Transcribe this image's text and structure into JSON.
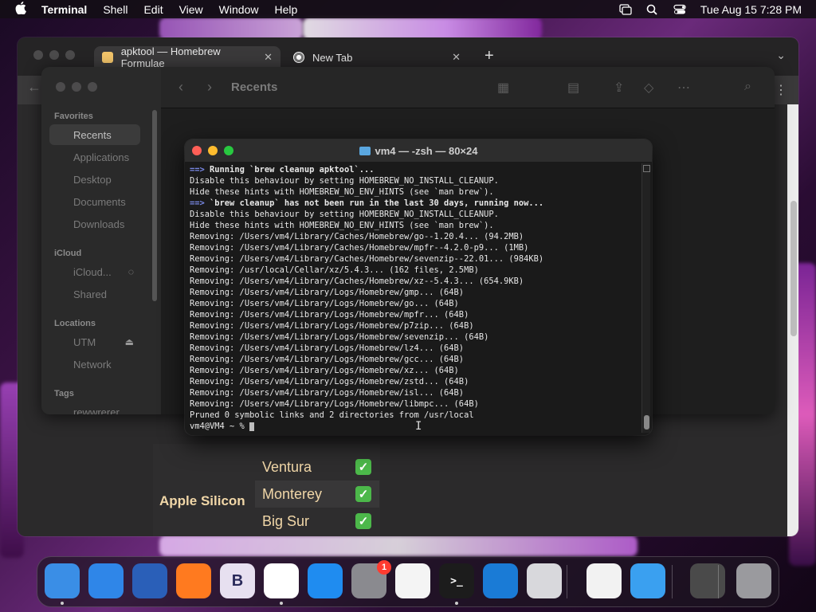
{
  "menubar": {
    "app_name": "Terminal",
    "items": [
      "Shell",
      "Edit",
      "View",
      "Window",
      "Help"
    ],
    "clock": "Tue Aug 15  7:28 PM"
  },
  "browser": {
    "tabs": [
      {
        "title": "apktool — Homebrew Formulae",
        "close": "✕"
      },
      {
        "title": "New Tab",
        "close": "✕"
      }
    ],
    "new_tab": "+"
  },
  "page_table": {
    "group_label": "Apple Silicon",
    "rows": [
      {
        "os": "Ventura",
        "check": "✓"
      },
      {
        "os": "Monterey",
        "check": "✓"
      },
      {
        "os": "Big Sur",
        "check": "✓"
      }
    ]
  },
  "finder": {
    "title": "Recents",
    "sections": {
      "favorites": "Favorites",
      "icloud": "iCloud",
      "locations": "Locations",
      "tags": "Tags"
    },
    "favorites": [
      "Recents",
      "Applications",
      "Desktop",
      "Documents",
      "Downloads"
    ],
    "icloud": [
      "iCloud...",
      "Shared"
    ],
    "locations": [
      "UTM",
      "Network"
    ],
    "tags": [
      "rewwrerer"
    ]
  },
  "terminal": {
    "title": "vm4 — -zsh — 80×24",
    "lines": [
      {
        "arrow": "==>",
        "text": " Running `brew cleanup apktool`...",
        "bold": true
      },
      {
        "text": "Disable this behaviour by setting HOMEBREW_NO_INSTALL_CLEANUP."
      },
      {
        "text": "Hide these hints with HOMEBREW_NO_ENV_HINTS (see `man brew`)."
      },
      {
        "arrow": "==>",
        "text": " `brew cleanup` has not been run in the last 30 days, running now...",
        "bold": true
      },
      {
        "text": "Disable this behaviour by setting HOMEBREW_NO_INSTALL_CLEANUP."
      },
      {
        "text": "Hide these hints with HOMEBREW_NO_ENV_HINTS (see `man brew`)."
      },
      {
        "text": "Removing: /Users/vm4/Library/Caches/Homebrew/go--1.20.4... (94.2MB)"
      },
      {
        "text": "Removing: /Users/vm4/Library/Caches/Homebrew/mpfr--4.2.0-p9... (1MB)"
      },
      {
        "text": "Removing: /Users/vm4/Library/Caches/Homebrew/sevenzip--22.01... (984KB)"
      },
      {
        "text": "Removing: /usr/local/Cellar/xz/5.4.3... (162 files, 2.5MB)"
      },
      {
        "text": "Removing: /Users/vm4/Library/Caches/Homebrew/xz--5.4.3... (654.9KB)"
      },
      {
        "text": "Removing: /Users/vm4/Library/Logs/Homebrew/gmp... (64B)"
      },
      {
        "text": "Removing: /Users/vm4/Library/Logs/Homebrew/go... (64B)"
      },
      {
        "text": "Removing: /Users/vm4/Library/Logs/Homebrew/mpfr... (64B)"
      },
      {
        "text": "Removing: /Users/vm4/Library/Logs/Homebrew/p7zip... (64B)"
      },
      {
        "text": "Removing: /Users/vm4/Library/Logs/Homebrew/sevenzip... (64B)"
      },
      {
        "text": "Removing: /Users/vm4/Library/Logs/Homebrew/lz4... (64B)"
      },
      {
        "text": "Removing: /Users/vm4/Library/Logs/Homebrew/gcc... (64B)"
      },
      {
        "text": "Removing: /Users/vm4/Library/Logs/Homebrew/xz... (64B)"
      },
      {
        "text": "Removing: /Users/vm4/Library/Logs/Homebrew/zstd... (64B)"
      },
      {
        "text": "Removing: /Users/vm4/Library/Logs/Homebrew/isl... (64B)"
      },
      {
        "text": "Removing: /Users/vm4/Library/Logs/Homebrew/libmpc... (64B)"
      },
      {
        "text": "Pruned 0 symbolic links and 2 directories from /usr/local"
      }
    ],
    "prompt": "vm4@VM4 ~ % "
  },
  "dock": {
    "apps": [
      {
        "name": "finder",
        "label": "",
        "color": "#3a8ee6",
        "running": true
      },
      {
        "name": "safari",
        "label": "",
        "color": "#2f86e8",
        "running": false
      },
      {
        "name": "utm",
        "label": "",
        "color": "#2a5fb8",
        "running": false
      },
      {
        "name": "firefox",
        "label": "",
        "color": "#ff7a1f",
        "running": false
      },
      {
        "name": "bbedit",
        "label": "B",
        "color": "#e7e0f0",
        "running": false
      },
      {
        "name": "chrome",
        "label": "",
        "color": "#ffffff",
        "running": true
      },
      {
        "name": "app-store",
        "label": "",
        "color": "#1f8cf0",
        "running": false
      },
      {
        "name": "system-settings",
        "label": "",
        "color": "#8a8a8f",
        "running": false,
        "badge": "1"
      },
      {
        "name": "textedit",
        "label": "",
        "color": "#f4f4f4",
        "running": false
      },
      {
        "name": "terminal",
        "label": ">_",
        "color": "#1c1c1c",
        "running": true
      },
      {
        "name": "vscode",
        "label": "",
        "color": "#1a7bd6",
        "running": false
      },
      {
        "name": "launchpad",
        "label": "",
        "color": "#d8d8dc",
        "running": false
      },
      {
        "name": "visual-studio",
        "label": "",
        "color": "#f2f2f2",
        "running": false
      },
      {
        "name": "icloud-weather",
        "label": "",
        "color": "#3aa0f0",
        "running": false
      },
      {
        "name": "downloads-stack",
        "label": "",
        "color": "#4a4a4a",
        "running": false
      },
      {
        "name": "trash",
        "label": "",
        "color": "#9a9a9e",
        "running": false
      }
    ]
  },
  "colors": {
    "terminal_bg": "#1a1a1a",
    "prompt_arrow": "#7a8ae8",
    "close": "#ff5f57",
    "minimize": "#febc2e",
    "zoom": "#28c840",
    "checkmark": "#4cb84a",
    "silicon_text": "#f1d7a8"
  }
}
